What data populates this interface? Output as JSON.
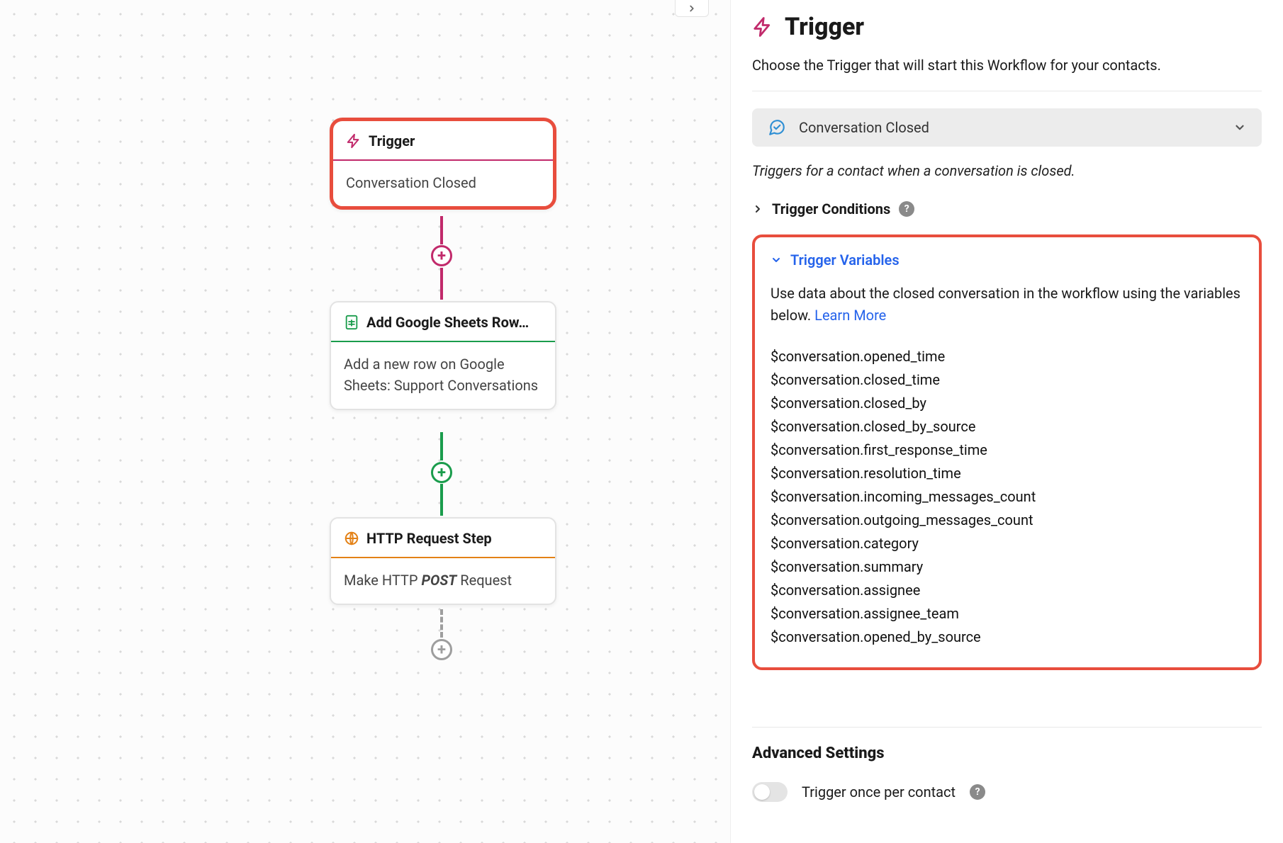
{
  "canvas": {
    "trigger": {
      "title": "Trigger",
      "subtitle": "Conversation Closed"
    },
    "sheets": {
      "title": "Add Google Sheets Row…",
      "subtitle": "Add a new row on Google Sheets: Support Conversations"
    },
    "http": {
      "title": "HTTP Request Step",
      "prefix": "Make HTTP ",
      "method": "POST",
      "suffix": " Request"
    }
  },
  "panel": {
    "title": "Trigger",
    "description": "Choose the Trigger that will start this Workflow for your contacts.",
    "trigger_select": "Conversation Closed",
    "trigger_hint": "Triggers for a contact when a conversation is closed.",
    "conditions_label": "Trigger Conditions",
    "variables_label": "Trigger Variables",
    "variables_desc": "Use data about the closed conversation in the workflow using the variables below. ",
    "learn_more": "Learn More",
    "variables": [
      "$conversation.opened_time",
      "$conversation.closed_time",
      "$conversation.closed_by",
      "$conversation.closed_by_source",
      "$conversation.first_response_time",
      "$conversation.resolution_time",
      "$conversation.incoming_messages_count",
      "$conversation.outgoing_messages_count",
      "$conversation.category",
      "$conversation.summary",
      "$conversation.assignee",
      "$conversation.assignee_team",
      "$conversation.opened_by_source"
    ],
    "advanced_heading": "Advanced Settings",
    "toggle_once_label": "Trigger once per contact"
  }
}
